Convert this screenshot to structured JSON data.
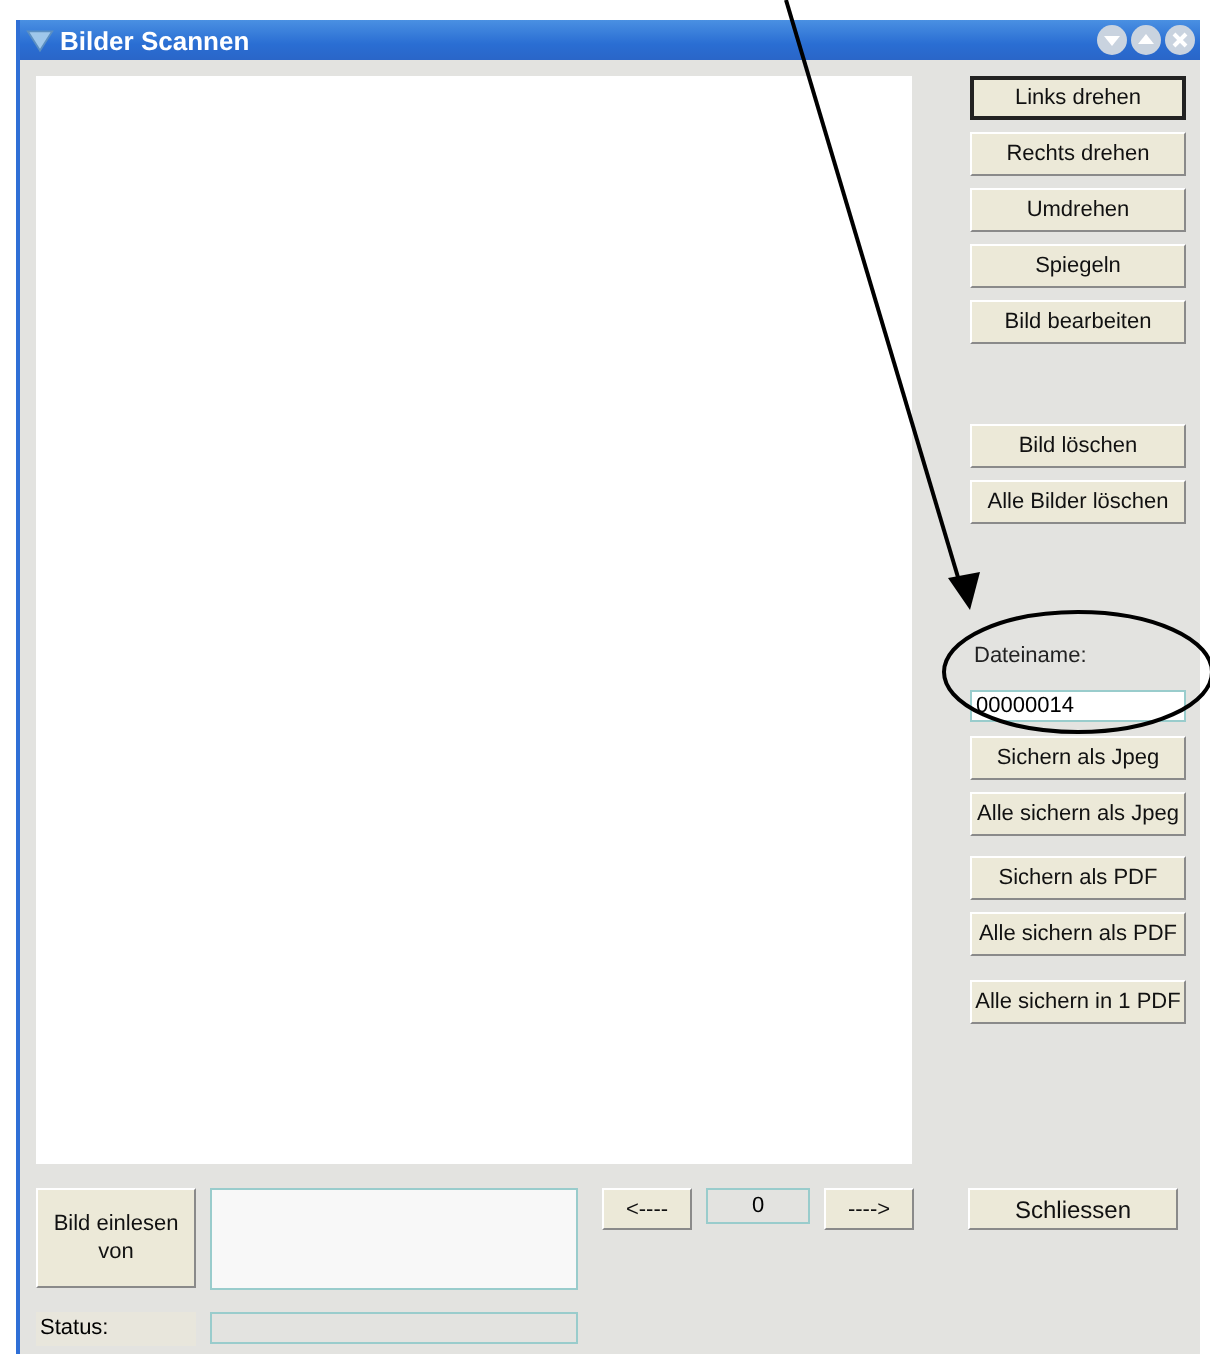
{
  "window": {
    "title": "Bilder Scannen"
  },
  "side_groups": [
    {
      "buttons": [
        {
          "label": "Links drehen",
          "default": true
        },
        {
          "label": "Rechts drehen",
          "default": false
        },
        {
          "label": "Umdrehen",
          "default": false
        },
        {
          "label": "Spiegeln",
          "default": false
        },
        {
          "label": "Bild bearbeiten",
          "default": false
        }
      ]
    },
    {
      "buttons": [
        {
          "label": "Bild löschen",
          "default": false
        },
        {
          "label": "Alle Bilder löschen",
          "default": false
        }
      ]
    }
  ],
  "filename": {
    "label": "Dateiname:",
    "value": "00000014"
  },
  "save_groups": [
    {
      "buttons": [
        {
          "label": "Sichern als Jpeg",
          "default": false
        },
        {
          "label": "Alle sichern als Jpeg",
          "default": false
        }
      ]
    },
    {
      "buttons": [
        {
          "label": "Sichern als PDF",
          "default": false
        },
        {
          "label": "Alle sichern als PDF",
          "default": false
        }
      ]
    },
    {
      "buttons": [
        {
          "label": "Alle sichern in 1 PDF",
          "default": false
        }
      ]
    }
  ],
  "source_button": "Bild einlesen von",
  "navigation": {
    "previous": "<----",
    "counter": "0",
    "next": "---->"
  },
  "close_button": "Schliessen",
  "status": {
    "label": "Status:"
  }
}
